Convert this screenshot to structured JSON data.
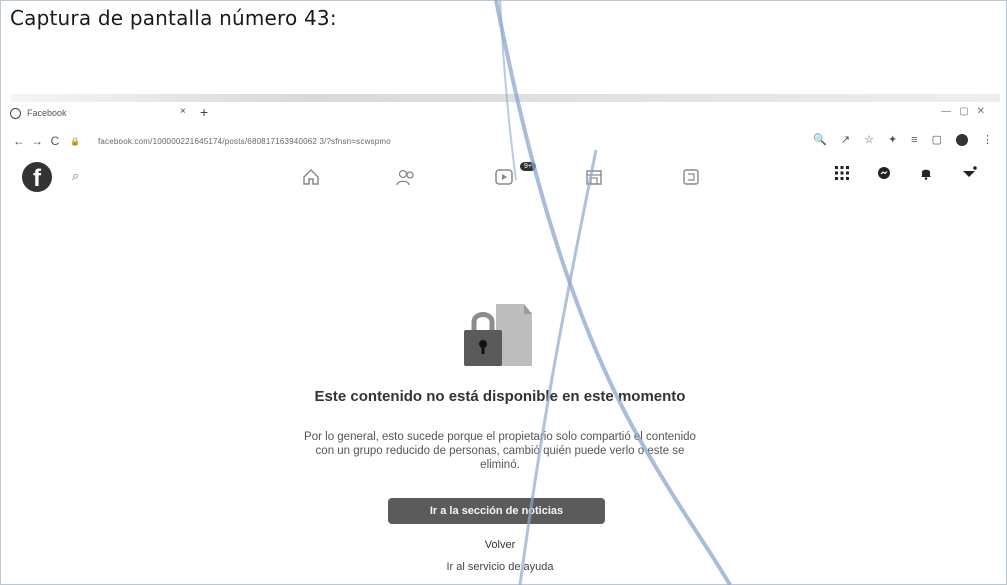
{
  "caption": "Captura de pantalla número 43:",
  "browser": {
    "tab_title": "Facebook",
    "tab_close": "×",
    "new_tab": "+",
    "url": "facebook.com/100000221645174/posts/680817163940062 3/?sfnsn=scwspmo",
    "nav": {
      "back": "←",
      "forward": "→",
      "reload": "C"
    }
  },
  "facebook": {
    "logo": "f",
    "notification_badge": "9+"
  },
  "content": {
    "title": "Este contenido no está disponible en este momento",
    "description": "Por lo general, esto sucede porque el propietario solo compartió el contenido con un grupo reducido de personas, cambió quién puede verlo o este se eliminó.",
    "primary_button": "Ir a la sección de noticias",
    "back_link": "Volver",
    "help_link": "Ir al servicio de ayuda"
  },
  "colors": {
    "pen_stroke": "#8ea6cf",
    "button_bg": "#5b5b5b"
  },
  "icons": [
    "facebook-logo-icon",
    "search-icon",
    "home-icon",
    "friends-icon",
    "watch-icon",
    "marketplace-icon",
    "gaming-icon",
    "menu-grid-icon",
    "messenger-icon",
    "notifications-icon",
    "account-icon",
    "padlock-icon"
  ]
}
